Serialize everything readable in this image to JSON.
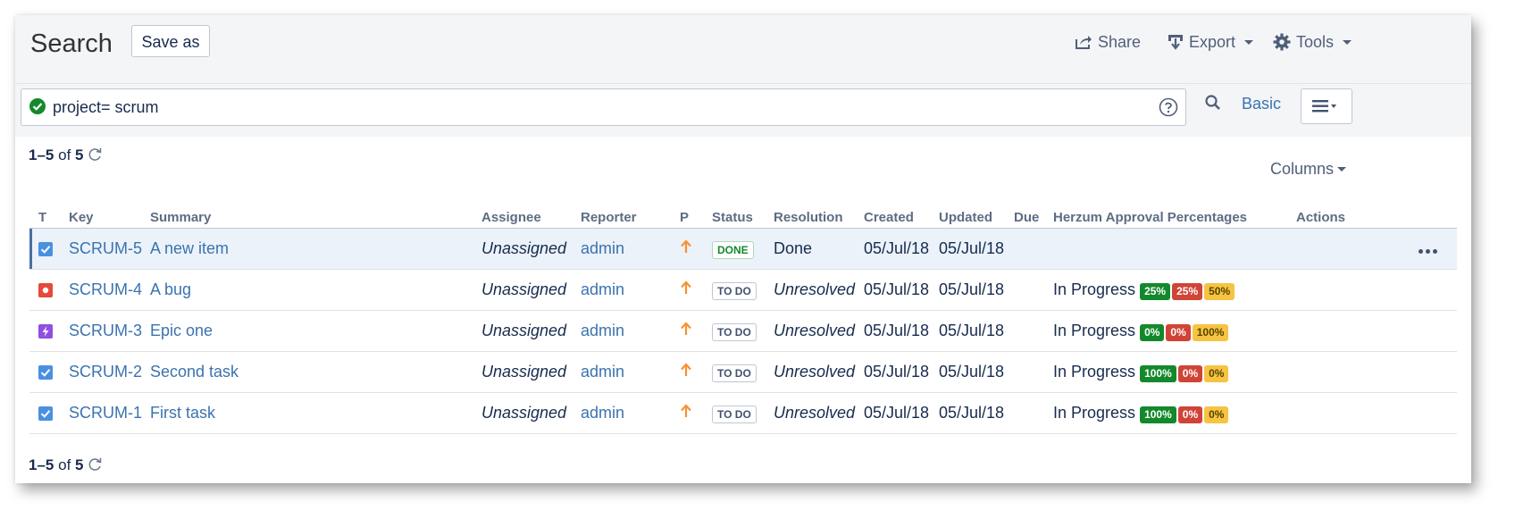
{
  "header": {
    "title": "Search",
    "save_as_label": "Save as",
    "share_label": "Share",
    "export_label": "Export",
    "tools_label": "Tools"
  },
  "query": {
    "text": "project= scrum",
    "basic_label": "Basic"
  },
  "results": {
    "range": "1–5",
    "of_label": "of",
    "total": "5",
    "columns_label": "Columns"
  },
  "table": {
    "headers": [
      "T",
      "Key",
      "Summary",
      "Assignee",
      "Reporter",
      "P",
      "Status",
      "Resolution",
      "Created",
      "Updated",
      "Due",
      "Herzum Approval Percentages",
      "Actions"
    ],
    "rows": [
      {
        "type_icon": "story-check-icon",
        "key": "SCRUM-5",
        "summary": "A new item",
        "assignee": "Unassigned",
        "reporter": "admin",
        "status": "DONE",
        "resolution": "Done",
        "created": "05/Jul/18",
        "updated": "05/Jul/18",
        "approval_label": "",
        "percentages": []
      },
      {
        "type_icon": "bug-icon",
        "key": "SCRUM-4",
        "summary": "A bug",
        "assignee": "Unassigned",
        "reporter": "admin",
        "status": "TO DO",
        "resolution": "Unresolved",
        "created": "05/Jul/18",
        "updated": "05/Jul/18",
        "approval_label": "In Progress",
        "percentages": [
          "25%",
          "25%",
          "50%"
        ]
      },
      {
        "type_icon": "epic-icon",
        "key": "SCRUM-3",
        "summary": "Epic one",
        "assignee": "Unassigned",
        "reporter": "admin",
        "status": "TO DO",
        "resolution": "Unresolved",
        "created": "05/Jul/18",
        "updated": "05/Jul/18",
        "approval_label": "In Progress",
        "percentages": [
          "0%",
          "0%",
          "100%"
        ]
      },
      {
        "type_icon": "task-check-icon",
        "key": "SCRUM-2",
        "summary": "Second task",
        "assignee": "Unassigned",
        "reporter": "admin",
        "status": "TO DO",
        "resolution": "Unresolved",
        "created": "05/Jul/18",
        "updated": "05/Jul/18",
        "approval_label": "In Progress",
        "percentages": [
          "100%",
          "0%",
          "0%"
        ]
      },
      {
        "type_icon": "task-check-icon",
        "key": "SCRUM-1",
        "summary": "First task",
        "assignee": "Unassigned",
        "reporter": "admin",
        "status": "TO DO",
        "resolution": "Unresolved",
        "created": "05/Jul/18",
        "updated": "05/Jul/18",
        "approval_label": "In Progress",
        "percentages": [
          "100%",
          "0%",
          "0%"
        ]
      }
    ]
  },
  "colors": {
    "link": "#3b73af",
    "approved_green": "#14892c",
    "rejected_red": "#d04437",
    "pending_yellow": "#f6c342",
    "priority_orange": "#f79232"
  }
}
